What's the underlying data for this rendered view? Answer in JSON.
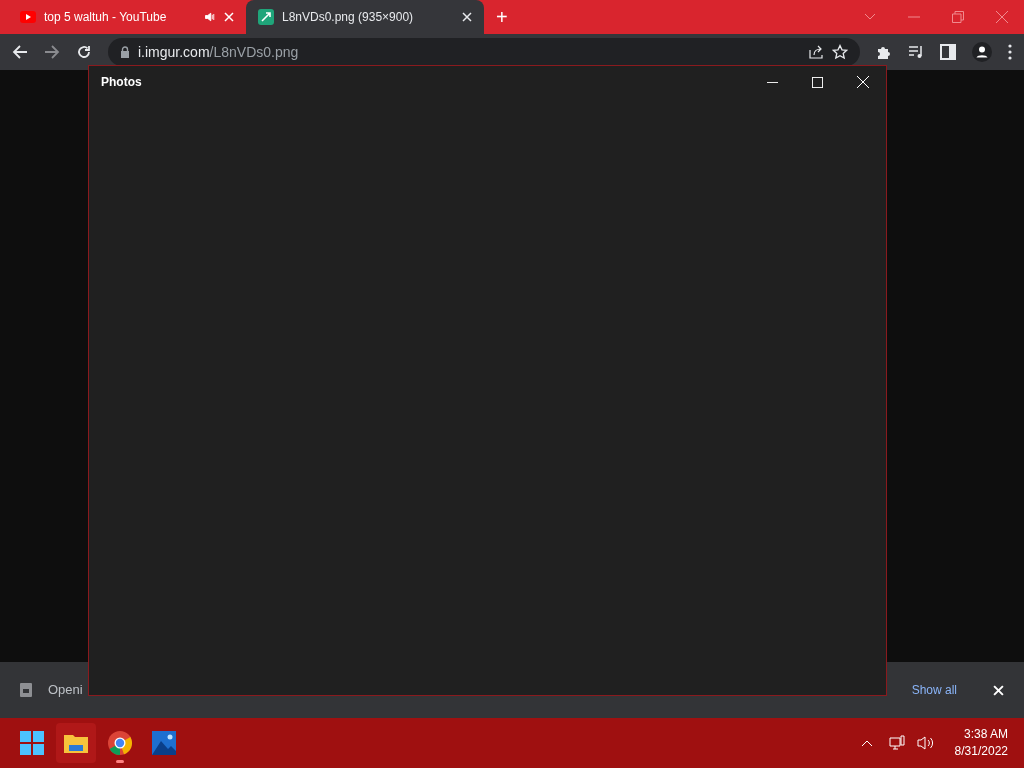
{
  "browser": {
    "tabs": [
      {
        "title": "top 5 waltuh - YouTube",
        "selected": false,
        "kind": "youtube",
        "audible": true
      },
      {
        "title": "L8nVDs0.png (935×900)",
        "selected": true,
        "kind": "image",
        "audible": false
      }
    ],
    "new_tab": "+",
    "address": {
      "host": "i.imgur.com",
      "path": "/L8nVDs0.png"
    }
  },
  "download_bar": {
    "item": "Openi",
    "show_all": "Show all"
  },
  "photos_window": {
    "title": "Photos"
  },
  "taskbar": {
    "apps": [
      {
        "kind": "start",
        "selected": false
      },
      {
        "kind": "explorer",
        "selected": true
      },
      {
        "kind": "chrome",
        "selected": false,
        "running": true
      },
      {
        "kind": "photos",
        "selected": false
      }
    ],
    "time": "3:38 AM",
    "date": "8/31/2022"
  }
}
